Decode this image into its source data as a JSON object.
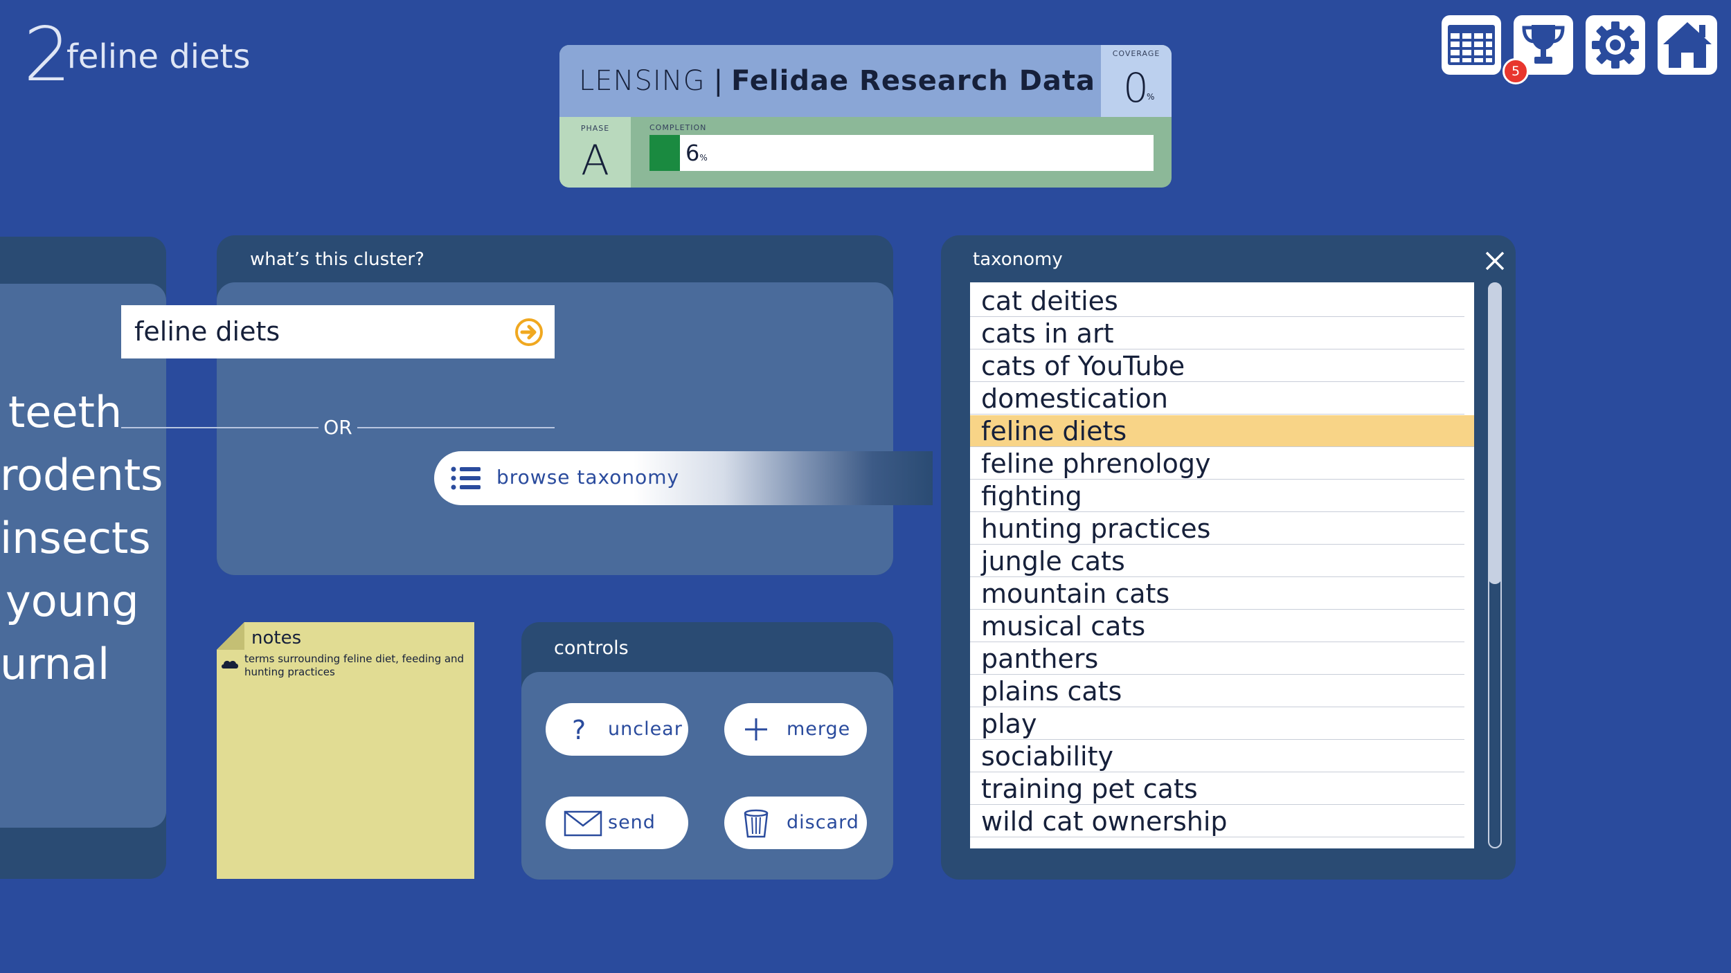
{
  "cluster": {
    "number": "2",
    "name": "feline diets"
  },
  "status": {
    "stage": "LENSING",
    "separator": "|",
    "project": "Felidae Research Data",
    "coverage_label": "COVERAGE",
    "coverage_value": "0",
    "coverage_unit": "%",
    "phase_label": "PHASE",
    "phase_value": "A",
    "completion_label": "COMPLETION",
    "completion_value": "6",
    "completion_unit": "%",
    "completion_fraction": 0.06
  },
  "toolbar": {
    "items": [
      {
        "icon": "table-icon"
      },
      {
        "icon": "trophy-icon",
        "badge": "5"
      },
      {
        "icon": "gear-icon"
      },
      {
        "icon": "home-icon"
      }
    ]
  },
  "cluster_words": [
    "teeth",
    "rodents",
    "insects",
    "young",
    "urnal"
  ],
  "cluster_panel": {
    "title": "what’s this cluster?",
    "input_value": "feline diets",
    "or_label": "OR",
    "browse_label": "browse taxonomy"
  },
  "notes": {
    "title": "notes",
    "text": "terms surrounding feline diet, feeding and hunting practices"
  },
  "controls": {
    "title": "controls",
    "unclear": "unclear",
    "merge": "merge",
    "send": "send",
    "discard": "discard"
  },
  "taxonomy": {
    "title": "taxonomy",
    "selected_index": 4,
    "items": [
      "cat deities",
      "cats in art",
      "cats of YouTube",
      "domestication",
      "feline diets",
      "feline phrenology",
      "fighting",
      "hunting practices",
      "jungle cats",
      "mountain cats",
      "musical cats",
      "panthers",
      "plains cats",
      "play",
      "sociability",
      "training pet cats",
      "wild cat ownership"
    ]
  },
  "colors": {
    "background": "#2a4b9d",
    "panel": "#2a4b73",
    "panel_inner": "#4a6b9b",
    "selection": "#f8d487",
    "progress": "#1a8a40",
    "badge": "#e8362e",
    "accent_text": "#2a4b9d",
    "go_arrow": "#f0a820"
  }
}
